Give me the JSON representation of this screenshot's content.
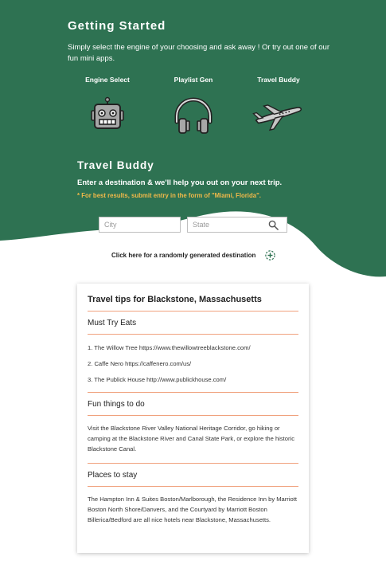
{
  "header": {
    "title": "Getting Started",
    "intro": "Simply select the engine of your choosing and ask away ! Or try out one of our fun mini apps."
  },
  "apps": [
    {
      "label": "Engine Select",
      "icon": "robot-icon"
    },
    {
      "label": "Playlist Gen",
      "icon": "headphones-icon"
    },
    {
      "label": "Travel Buddy",
      "icon": "airplane-icon"
    }
  ],
  "travel_buddy": {
    "title": "Travel Buddy",
    "subtitle": "Enter a destination & we'll help you out on your next trip.",
    "hint": "* For best results, submit entry in the form of \"Miami, Florida\".",
    "city_placeholder": "City",
    "state_placeholder": "State",
    "random_link": "Click here for a randomly generated destination",
    "random_icon": "crosshair-plus-icon",
    "search_icon": "search-icon"
  },
  "results": {
    "title": "Travel tips for Blackstone, Massachusetts",
    "eats": {
      "heading": "Must Try Eats",
      "items": [
        "1. The Willow Tree https://www.thewillowtreeblackstone.com/",
        "2. Caffe Nero https://caffenero.com/us/",
        "3. The Publick House http://www.publickhouse.com/"
      ]
    },
    "fun": {
      "heading": "Fun things to do",
      "text": "Visit the Blackstone River Valley National Heritage Corridor, go hiking or camping at the Blackstone River and Canal State Park, or explore the historic Blackstone Canal."
    },
    "stay": {
      "heading": "Places to stay",
      "text": "The Hampton Inn & Suites Boston/Marlborough, the Residence Inn by Marriott Boston North Shore/Danvers, and the Courtyard by Marriott Boston Billerica/Bedford are all nice hotels near Blackstone, Massachusetts."
    }
  },
  "colors": {
    "brand_green": "#2e7252",
    "accent_orange": "#f0a27e",
    "hint_yellow": "#f2b94a"
  }
}
